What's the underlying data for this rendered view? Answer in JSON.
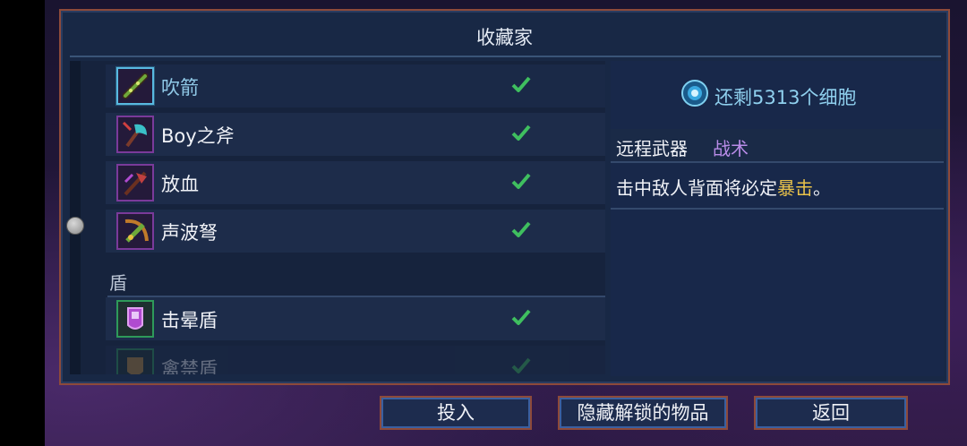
{
  "panel": {
    "title": "收藏家"
  },
  "list": {
    "items": [
      {
        "name": "吹箭",
        "icon": "blowgun-icon",
        "unlocked": true,
        "selected": true
      },
      {
        "name": "Boy之斧",
        "icon": "axe-icon",
        "unlocked": true
      },
      {
        "name": "放血",
        "icon": "bloodletting-icon",
        "unlocked": true
      },
      {
        "name": "声波弩",
        "icon": "sonic-crossbow-icon",
        "unlocked": true
      }
    ],
    "category": "盾",
    "shield_items": [
      {
        "name": "击晕盾",
        "icon": "stun-shield-icon",
        "unlocked": true
      },
      {
        "name": "禽禁盾",
        "icon": "shield-icon",
        "unlocked": true
      }
    ]
  },
  "details": {
    "cells_text": "还剩5313个细胞",
    "weapon_type": "远程武器",
    "weapon_tag": "战术",
    "description_prefix": "击中敌人背面将必定",
    "description_highlight": "暴击",
    "description_suffix": "。"
  },
  "buttons": {
    "invest": "投入",
    "hide_unlocked": "隐藏解锁的物品",
    "back": "返回"
  },
  "colors": {
    "panel_bg": "#182845",
    "frame": "#8d4a3a",
    "selected_text": "#8fc8e6",
    "tag": "#b98ce8",
    "highlight": "#e8c24a",
    "check": "#3fbf5f"
  }
}
